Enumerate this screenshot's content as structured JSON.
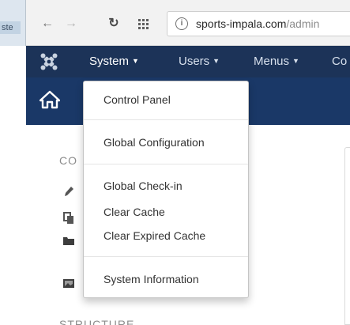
{
  "browser": {
    "left_tab_fragment": "ste",
    "url_domain": "sports-impala.com",
    "url_path": "/admin"
  },
  "nav": {
    "items": [
      {
        "label": "System",
        "active": true
      },
      {
        "label": "Users"
      },
      {
        "label": "Menus"
      },
      {
        "label": "Co"
      }
    ]
  },
  "sidebar": {
    "heading_top": "CO",
    "heading_bottom": "STRUCTURE"
  },
  "dropdown": {
    "items": [
      {
        "label": "Control Panel"
      },
      {
        "label": "Global Configuration"
      },
      {
        "label": "Global Check-in"
      },
      {
        "label": "Clear Cache"
      },
      {
        "label": "Clear Expired Cache"
      },
      {
        "label": "System Information"
      }
    ]
  },
  "colors": {
    "nav_bg": "#1c3358",
    "subheader_bg": "#1a3867",
    "browser_bar_bg": "#f2f2f2",
    "dropdown_text": "#333333"
  },
  "icons": {
    "back": "arrow-left-icon",
    "forward": "arrow-right-icon",
    "reload": "reload-icon",
    "apps": "apps-grid-icon",
    "site_info": "info-icon",
    "logo": "joomla-logo-icon",
    "home": "home-icon",
    "sidebar": [
      "pencil-icon",
      "copy-icon",
      "folder-icon",
      "image-icon"
    ]
  }
}
